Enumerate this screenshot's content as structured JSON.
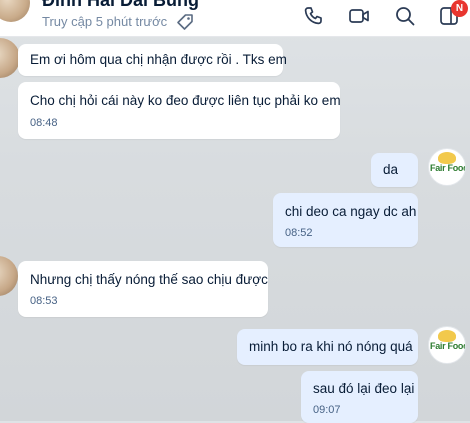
{
  "header": {
    "contact_name": "Đinh Hải Dai Bùng",
    "status": "Truy cập 5 phút trước",
    "badge": "N",
    "icons": [
      "tag-icon",
      "phone-icon",
      "video-call-icon",
      "search-icon",
      "sidebar-toggle-icon"
    ]
  },
  "logo_text": "Fair Food",
  "messages": [
    {
      "sender": "contact",
      "text": "Em ơi hôm qua chị nhận được rồi . Tks em",
      "time": ""
    },
    {
      "sender": "contact",
      "text": "Cho chị hỏi cái này ko đeo được liên tục phải ko em",
      "time": "08:48"
    },
    {
      "sender": "me",
      "text": "da",
      "time": ""
    },
    {
      "sender": "me",
      "text": "chi deo ca ngay dc ah",
      "time": "08:52"
    },
    {
      "sender": "contact",
      "text": "Nhưng chị thấy nóng thế sao chịu được",
      "time": "08:53"
    },
    {
      "sender": "me",
      "text": "minh bo ra khi nó nóng quá",
      "time": ""
    },
    {
      "sender": "me",
      "text": "sau đó lại đeo lại",
      "time": "09:07"
    }
  ],
  "colors": {
    "background": "#d8dcdf",
    "incoming_bubble": "#ffffff",
    "outgoing_bubble": "#e5efff",
    "badge": "#e8352f"
  }
}
